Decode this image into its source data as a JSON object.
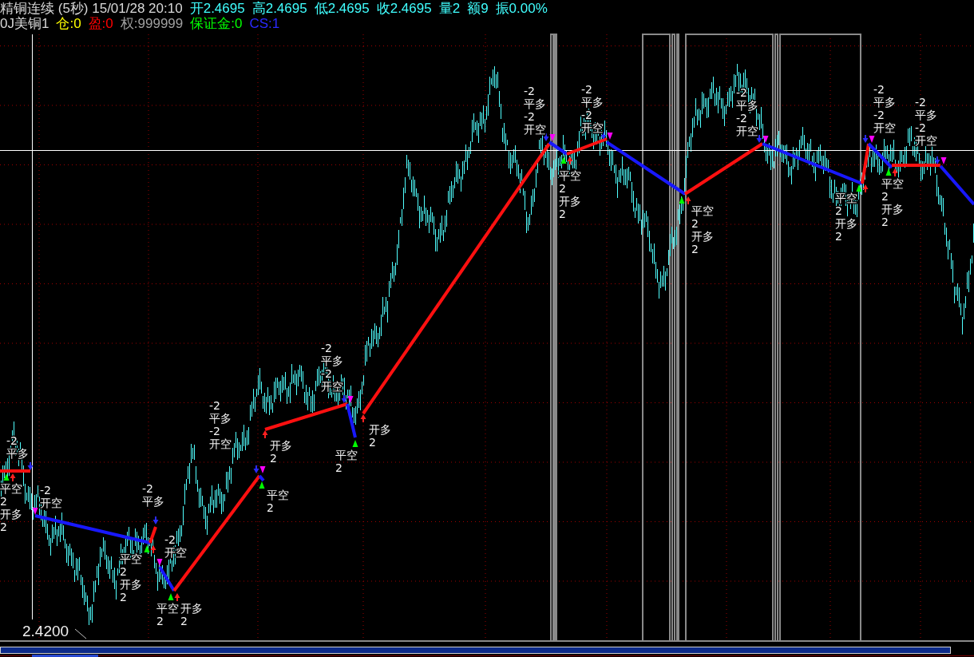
{
  "header": {
    "quote_line": [
      {
        "text": "精铜连续 (5秒) 15/01/28 20:10",
        "color": "#d8d8d8"
      },
      {
        "text": "开2.4695",
        "color": "#40ffff"
      },
      {
        "text": "高2.4695",
        "color": "#40ffff"
      },
      {
        "text": "低2.4695",
        "color": "#40ffff"
      },
      {
        "text": "收2.4695",
        "color": "#40ffff"
      },
      {
        "text": "量2",
        "color": "#40ffff"
      },
      {
        "text": "额9",
        "color": "#40ffff"
      },
      {
        "text": "振0.00%",
        "color": "#40ffff"
      }
    ],
    "account_line": [
      {
        "text": "0J美铜1",
        "color": "#d8d8d8"
      },
      {
        "text": "仓:0",
        "color": "#ffff00"
      },
      {
        "text": "盈:0",
        "color": "#ff0000"
      },
      {
        "text": "权:999999",
        "color": "#a0a0a0"
      },
      {
        "text": "保证金:0",
        "color": "#00ff00"
      },
      {
        "text": "CS:1",
        "color": "#2a2aff"
      }
    ]
  },
  "chart": {
    "axis_label": "2.4200",
    "trades": [
      {
        "kind": "long"
      },
      {
        "kind": "short"
      },
      {
        "kind": "long"
      },
      {
        "kind": "short"
      },
      {
        "kind": "long"
      },
      {
        "kind": "short"
      },
      {
        "kind": "long"
      },
      {
        "kind": "short"
      },
      {
        "kind": "long"
      },
      {
        "kind": "short"
      },
      {
        "kind": "long"
      },
      {
        "kind": "short"
      },
      {
        "kind": "long"
      },
      {
        "kind": "short"
      },
      {
        "kind": "long"
      },
      {
        "kind": "short"
      },
      {
        "kind": "long"
      },
      {
        "kind": "short"
      }
    ],
    "signals": [
      {
        "kind": "buy",
        "labels": [
          {
            "kind": "close_short",
            "action": "平空",
            "qty": "2"
          },
          {
            "kind": "open_long",
            "action": "开多",
            "qty": "2"
          }
        ]
      },
      {
        "kind": "sell",
        "labels": [
          {
            "kind": "close_long",
            "action": "平多",
            "qty": "-2"
          }
        ]
      },
      {
        "kind": "sell",
        "labels": [
          {
            "kind": "open_short",
            "action": "开空",
            "qty": "-2"
          }
        ]
      },
      {
        "kind": "buy",
        "labels": [
          {
            "kind": "close_short",
            "action": "平空",
            "qty": "2"
          },
          {
            "kind": "open_long",
            "action": "开多",
            "qty": "2"
          }
        ]
      },
      {
        "kind": "sell",
        "labels": [
          {
            "kind": "close_long",
            "action": "平多",
            "qty": "-2"
          }
        ]
      },
      {
        "kind": "sell",
        "labels": [
          {
            "kind": "open_short",
            "action": "开空",
            "qty": "-2"
          }
        ]
      },
      {
        "kind": "buy",
        "labels": [
          {
            "kind": "close_short",
            "action": "平空",
            "qty": "2"
          },
          {
            "kind": "open_long",
            "action": "开多",
            "qty": "2"
          }
        ]
      },
      {
        "kind": "sell",
        "labels": [
          {
            "kind": "close_long",
            "action": "平多",
            "qty": "-2"
          },
          {
            "kind": "open_short",
            "action": "开空",
            "qty": "-2"
          }
        ]
      },
      {
        "kind": "buy",
        "labels": [
          {
            "kind": "close_short",
            "action": "平空",
            "qty": "2"
          }
        ]
      },
      {
        "kind": "buy",
        "labels": [
          {
            "kind": "open_long",
            "action": "开多",
            "qty": "2"
          }
        ]
      },
      {
        "kind": "sell",
        "labels": [
          {
            "kind": "close_long",
            "action": "平多",
            "qty": "-2"
          },
          {
            "kind": "open_short",
            "action": "开空",
            "qty": "-2"
          }
        ]
      },
      {
        "kind": "buy",
        "labels": [
          {
            "kind": "close_short",
            "action": "平空",
            "qty": "2"
          }
        ]
      },
      {
        "kind": "buy",
        "labels": [
          {
            "kind": "open_long",
            "action": "开多",
            "qty": "2"
          }
        ]
      },
      {
        "kind": "sell",
        "labels": [
          {
            "kind": "close_long",
            "action": "平多",
            "qty": "-2"
          },
          {
            "kind": "open_short",
            "action": "开空",
            "qty": "-2"
          }
        ]
      },
      {
        "kind": "buy",
        "labels": [
          {
            "kind": "close_short",
            "action": "平空",
            "qty": "2"
          },
          {
            "kind": "open_long",
            "action": "开多",
            "qty": "2"
          }
        ]
      },
      {
        "kind": "sell",
        "labels": [
          {
            "kind": "close_long",
            "action": "平多",
            "qty": "-2"
          },
          {
            "kind": "open_short",
            "action": "开空",
            "qty": "-2"
          }
        ]
      },
      {
        "kind": "buy",
        "labels": [
          {
            "kind": "close_short",
            "action": "平空",
            "qty": "2"
          },
          {
            "kind": "open_long",
            "action": "开多",
            "qty": "2"
          }
        ]
      },
      {
        "kind": "sell",
        "labels": [
          {
            "kind": "close_long",
            "action": "平多",
            "qty": "-2"
          },
          {
            "kind": "open_short",
            "action": "开空",
            "qty": "-2"
          }
        ]
      },
      {
        "kind": "buy",
        "labels": [
          {
            "kind": "close_short",
            "action": "平空",
            "qty": "2"
          },
          {
            "kind": "open_long",
            "action": "开多",
            "qty": "2"
          }
        ]
      },
      {
        "kind": "sell",
        "labels": [
          {
            "kind": "close_long",
            "action": "平多",
            "qty": "-2"
          },
          {
            "kind": "open_short",
            "action": "开空",
            "qty": "-2"
          }
        ]
      },
      {
        "kind": "buy",
        "labels": [
          {
            "kind": "close_short",
            "action": "平空",
            "qty": "2"
          },
          {
            "kind": "open_long",
            "action": "开多",
            "qty": "2"
          }
        ]
      },
      {
        "kind": "sell",
        "labels": [
          {
            "kind": "close_long",
            "action": "平多",
            "qty": "-2"
          },
          {
            "kind": "open_short",
            "action": "开空",
            "qty": "-2"
          }
        ]
      }
    ]
  }
}
